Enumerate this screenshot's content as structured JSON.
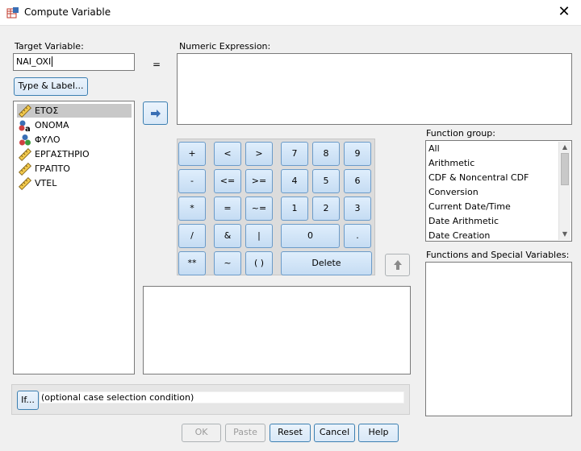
{
  "window": {
    "title": "Compute Variable"
  },
  "target_variable": {
    "label": "Target Variable:",
    "value": "NAI_OXI"
  },
  "equals_sign": "=",
  "numeric_expression": {
    "label": "Numeric Expression:",
    "value": ""
  },
  "type_label_button": "Type & Label...",
  "variables": [
    {
      "name": "ΕΤΟΣ",
      "icon": "scale-ruler-icon"
    },
    {
      "name": "ΟΝΟΜΑ",
      "icon": "nominal-string-icon"
    },
    {
      "name": "ΦΥΛΟ",
      "icon": "nominal-icon"
    },
    {
      "name": "ΕΡΓΑΣΤΗΡΙΟ",
      "icon": "scale-ruler-icon"
    },
    {
      "name": "ΓΡΑΠΤΟ",
      "icon": "scale-ruler-icon"
    },
    {
      "name": "VTEL",
      "icon": "scale-ruler-icon"
    }
  ],
  "calculator": {
    "keys": [
      "+",
      "<",
      ">",
      "7",
      "8",
      "9",
      "-",
      "<=",
      ">=",
      "4",
      "5",
      "6",
      "*",
      "=",
      "~=",
      "1",
      "2",
      "3",
      "/",
      "&",
      "|",
      "0",
      ".",
      "**",
      "~",
      "( )",
      "Delete"
    ]
  },
  "function_group": {
    "label": "Function group:",
    "items": [
      "All",
      "Arithmetic",
      "CDF & Noncentral CDF",
      "Conversion",
      "Current Date/Time",
      "Date Arithmetic",
      "Date Creation"
    ]
  },
  "functions_special": {
    "label": "Functions and Special Variables:"
  },
  "if_panel": {
    "button": "If...",
    "condition_text": "(optional case selection condition)"
  },
  "footer": {
    "ok": "OK",
    "paste": "Paste",
    "reset": "Reset",
    "cancel": "Cancel",
    "help": "Help"
  },
  "colors": {
    "accent_border": "#3c7fb1",
    "key_fill": "#c5dcf3",
    "selection": "#c8c8c8"
  }
}
